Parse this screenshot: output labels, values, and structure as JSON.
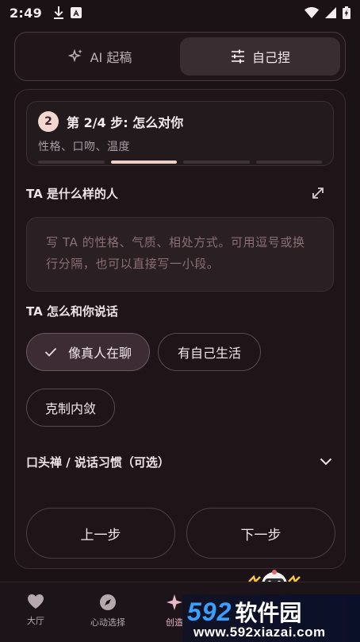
{
  "status_bar": {
    "time": "2:49"
  },
  "mode_switch": {
    "ai_draft": "AI 起稿",
    "manual": "自己捏",
    "active": "manual"
  },
  "step": {
    "number": "2",
    "title": "第 2/4 步: 怎么对你",
    "subtitle": "性格、口吻、温度",
    "total": 4,
    "current": 2
  },
  "personality": {
    "label": "TA 是什么样的人",
    "placeholder": "写 TA 的性格、气质、相处方式。可用逗号或换行分隔，也可以直接写一小段。"
  },
  "speaking": {
    "label": "TA 怎么和你说话",
    "options": [
      "像真人在聊",
      "有自己生活",
      "克制内敛"
    ],
    "selected": "像真人在聊"
  },
  "catchphrase": {
    "label": "口头禅 / 说话习惯（可选）"
  },
  "buttons": {
    "prev": "上一步",
    "next": "下一步"
  },
  "bottom_nav": {
    "items": [
      "大厅",
      "心动选择",
      "创造"
    ]
  },
  "watermark": {
    "num": "592",
    "name": "软件园",
    "url": "www.592xiazai.com"
  },
  "colors": {
    "accent": "#f0cfc7",
    "background": "#1b1216",
    "card": "#1f1519"
  }
}
